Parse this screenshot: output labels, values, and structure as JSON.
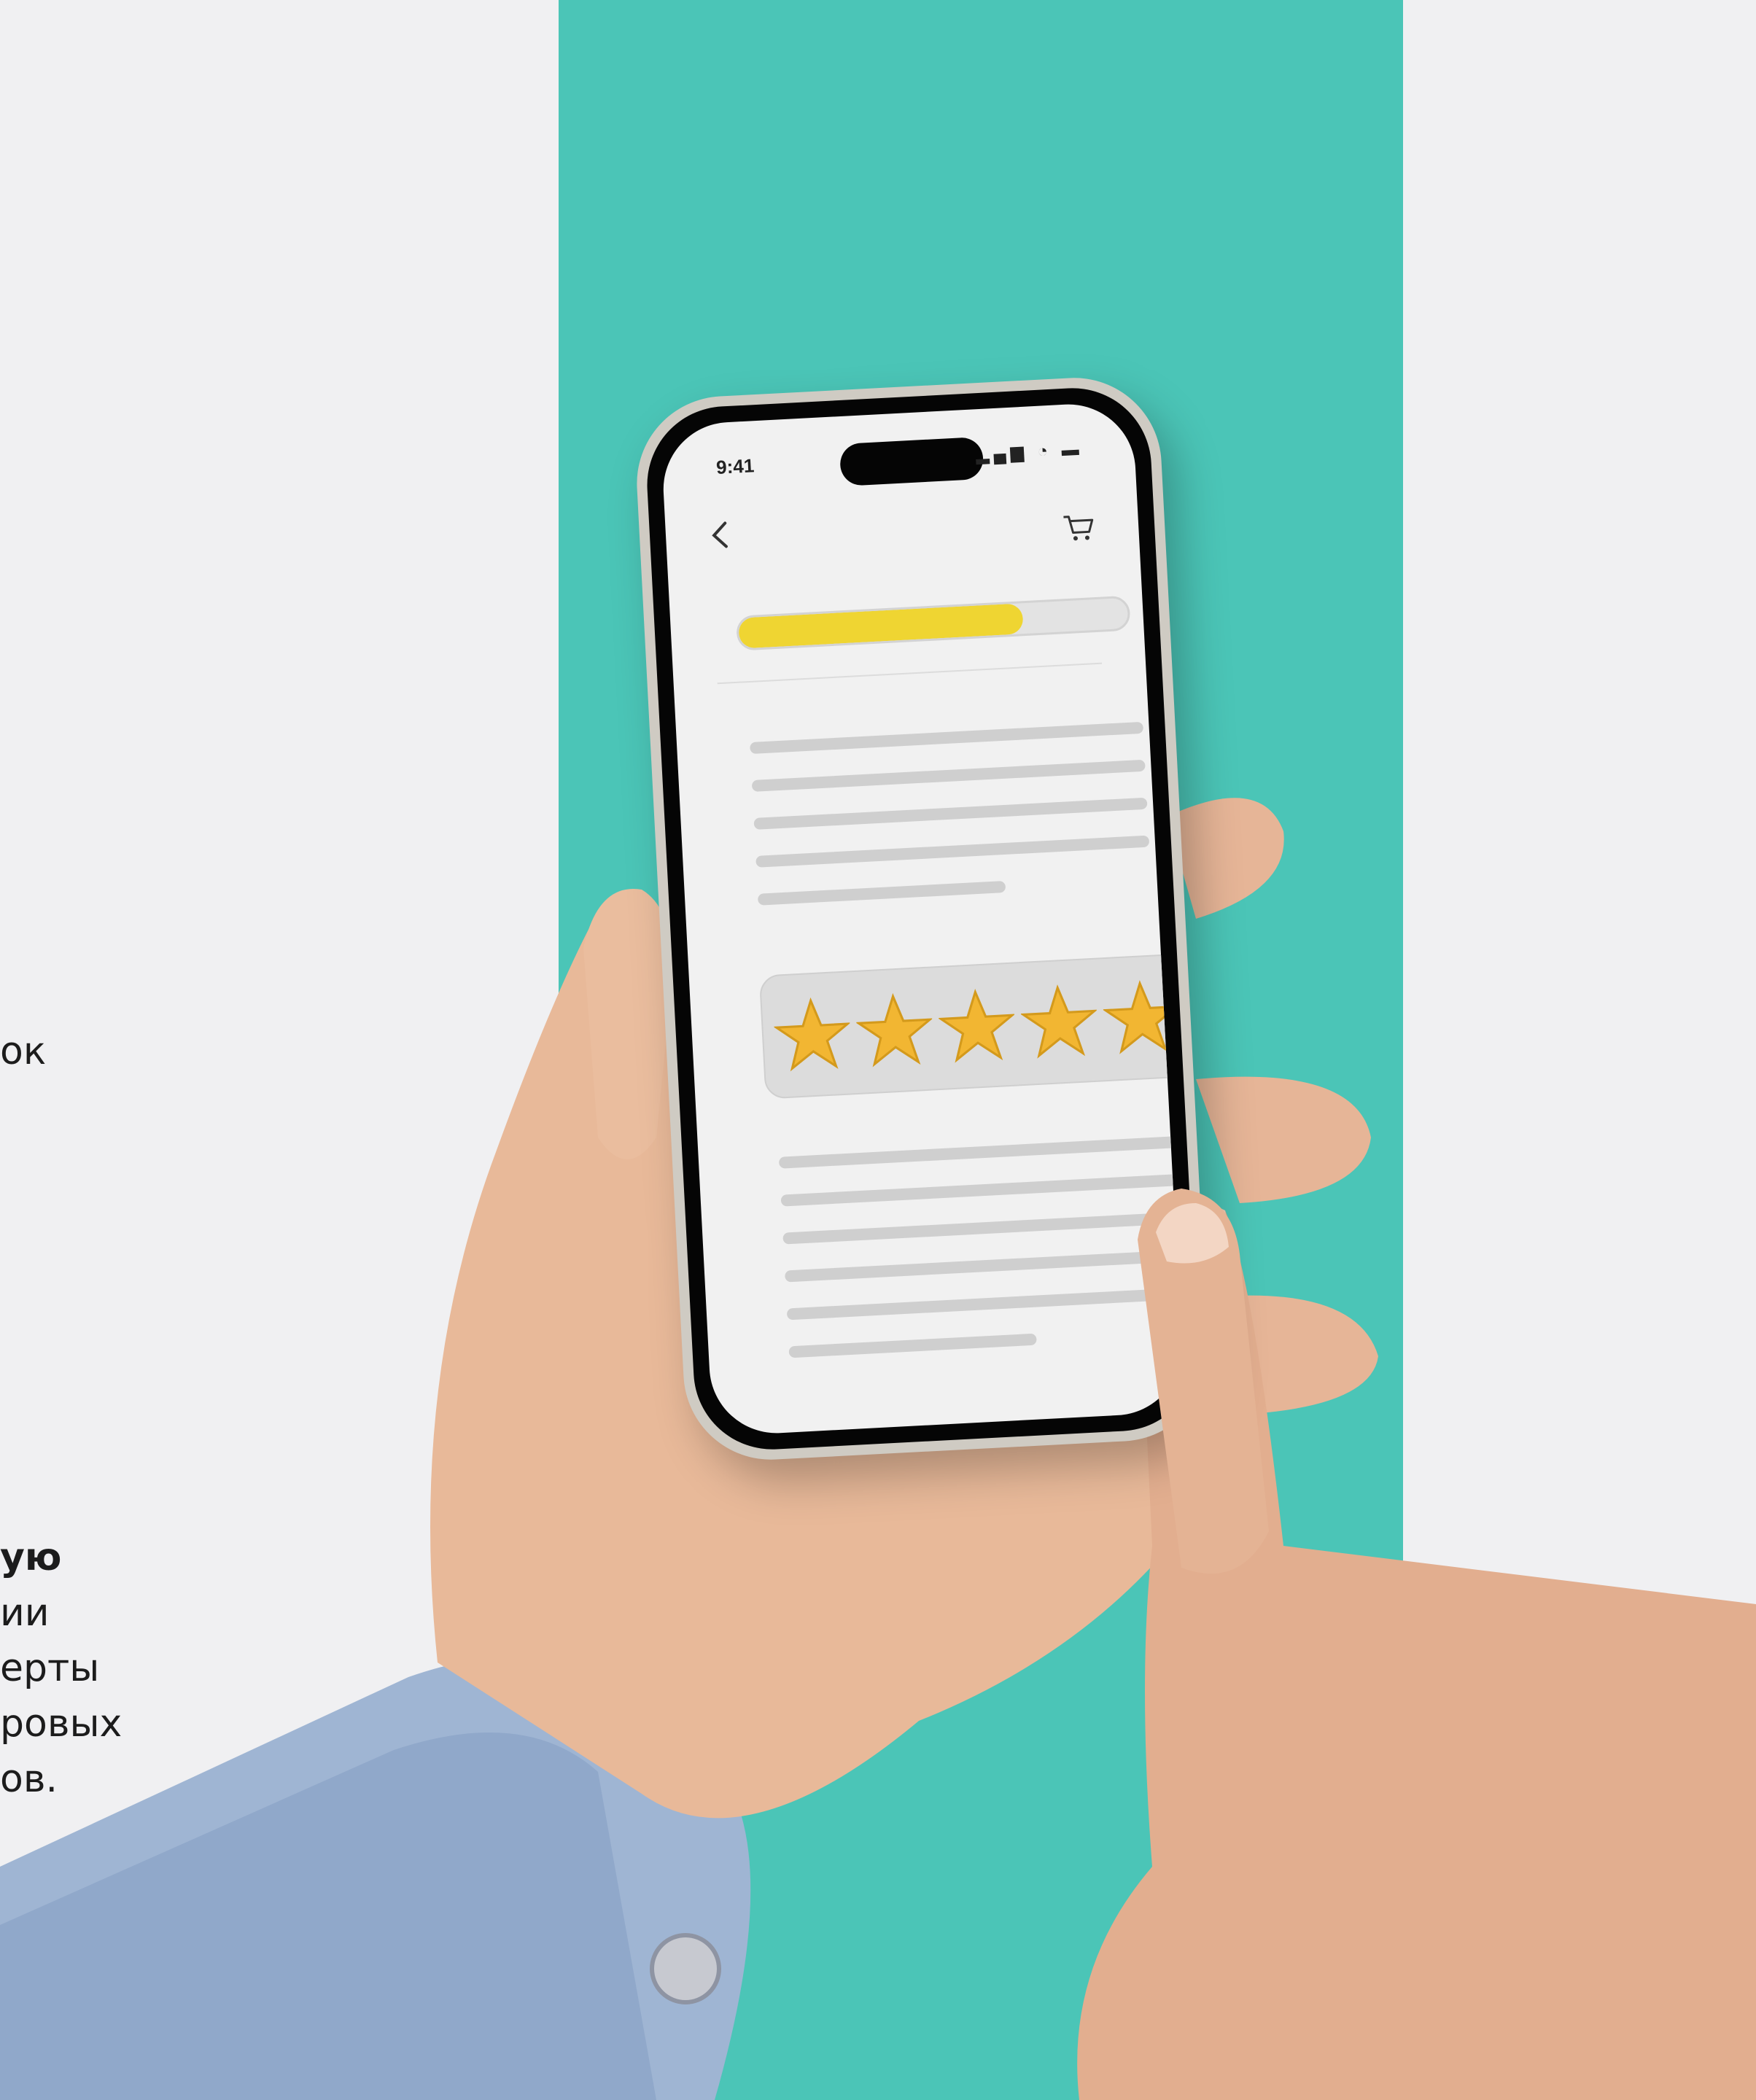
{
  "side_text_1": {
    "line1": "ок"
  },
  "side_text_2": {
    "line1": "ую",
    "line2": "ии",
    "line3": "ерты",
    "line4": "ровых",
    "line5": "ов."
  },
  "phone": {
    "status_time": "9:41",
    "status_icons": "▂▄▆ ◔ ▬",
    "progress": 0.73,
    "rating": {
      "value": 5,
      "max": 5
    }
  },
  "colors": {
    "teal": "#4bc5b7",
    "background": "#f0f0f2",
    "progress_yellow": "#efd532",
    "star_gold": "#f2b632"
  },
  "icons": [
    "back-chevron-icon",
    "cart-icon",
    "star-icon"
  ]
}
